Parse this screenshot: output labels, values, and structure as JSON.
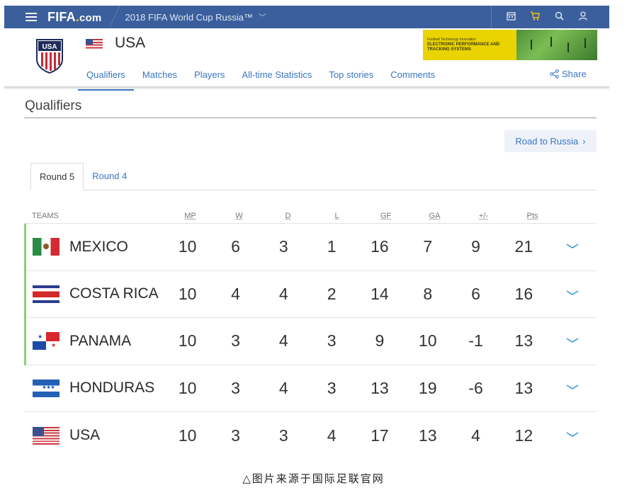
{
  "topbar": {
    "logo_text": "FIFA",
    "logo_dot": ".",
    "logo_suffix": "com",
    "edition": "2018 FIFA World Cup Russia™",
    "icons": [
      "calendar-icon",
      "cart-icon",
      "search-icon",
      "user-icon"
    ]
  },
  "team": {
    "name": "USA",
    "crest_text": "USA"
  },
  "ad": {
    "small_text": "Football Technology Innovation",
    "headline": "ELECTRONIC PERFORMANCE AND TRACKING SYSTEMS"
  },
  "nav": {
    "items": [
      "Qualifiers",
      "Matches",
      "Players",
      "All-time Statistics",
      "Top stories",
      "Comments"
    ],
    "active": "Qualifiers",
    "share": "Share"
  },
  "page": {
    "title": "Qualifiers",
    "road_button": "Road to Russia",
    "road_chevron": "›"
  },
  "round_tabs": {
    "items": [
      "Round 5",
      "Round 4"
    ],
    "active": "Round 5"
  },
  "table": {
    "headers": [
      "TEAMS",
      "MP",
      "W",
      "D",
      "L",
      "GF",
      "GA",
      "+/-",
      "Pts"
    ],
    "rows": [
      {
        "team": "MEXICO",
        "flag": "mexico-flag",
        "qualified": true,
        "mp": "10",
        "w": "6",
        "d": "3",
        "l": "1",
        "gf": "16",
        "ga": "7",
        "gd": "9",
        "pts": "21"
      },
      {
        "team": "COSTA RICA",
        "flag": "costa-rica-flag",
        "qualified": true,
        "mp": "10",
        "w": "4",
        "d": "4",
        "l": "2",
        "gf": "14",
        "ga": "8",
        "gd": "6",
        "pts": "16"
      },
      {
        "team": "PANAMA",
        "flag": "panama-flag",
        "qualified": true,
        "mp": "10",
        "w": "3",
        "d": "4",
        "l": "3",
        "gf": "9",
        "ga": "10",
        "gd": "-1",
        "pts": "13"
      },
      {
        "team": "HONDURAS",
        "flag": "honduras-flag",
        "qualified": false,
        "mp": "10",
        "w": "3",
        "d": "4",
        "l": "3",
        "gf": "13",
        "ga": "19",
        "gd": "-6",
        "pts": "13"
      },
      {
        "team": "USA",
        "flag": "usa-flag",
        "qualified": false,
        "mp": "10",
        "w": "3",
        "d": "3",
        "l": "4",
        "gf": "17",
        "ga": "13",
        "gd": "4",
        "pts": "12"
      }
    ]
  },
  "caption": "△图片来源于国际足联官网",
  "colors": {
    "topbar": "#3a5f9c",
    "link": "#3a76c4",
    "qualified_marker": "#8ad07a",
    "ad_yellow": "#e9d300"
  }
}
